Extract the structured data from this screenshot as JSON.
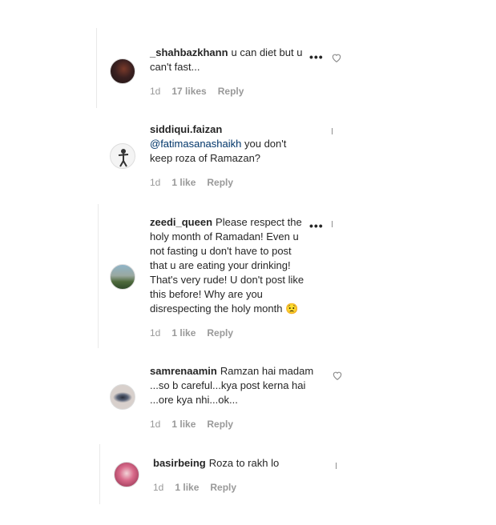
{
  "comments": [
    {
      "username": "_shahbazkhann",
      "lines": [
        "u can diet but u",
        "can't fast..."
      ],
      "age": "1d",
      "likes": "17 likes",
      "reply": "Reply",
      "more": "•••"
    },
    {
      "username": "siddiqui.faizan",
      "mention": "@fatimasanashaikh",
      "lines": [
        "you don't",
        "keep roza of Ramazan?"
      ],
      "age": "1d",
      "likes": "1 like",
      "reply": "Reply"
    },
    {
      "username": "zeedi_queen",
      "lines": [
        "Please respect the",
        "holy month of Ramadan! Even u",
        "not fasting u don't have to post",
        "that u are eating your drinking!",
        "That's very rude! U don't post like",
        "this before! Why are you",
        "disrespecting the holy month 😟"
      ],
      "age": "1d",
      "likes": "1 like",
      "reply": "Reply",
      "more": "•••"
    },
    {
      "username": "samrenaamin",
      "lines": [
        "Ramzan hai madam",
        "...so b careful...kya post kerna hai",
        "...ore kya nhi...ok..."
      ],
      "age": "1d",
      "likes": "1 like",
      "reply": "Reply"
    },
    {
      "username": "basirbeing",
      "lines": [
        "Roza to rakh lo"
      ],
      "age": "1d",
      "likes": "1 like",
      "reply": "Reply"
    }
  ]
}
